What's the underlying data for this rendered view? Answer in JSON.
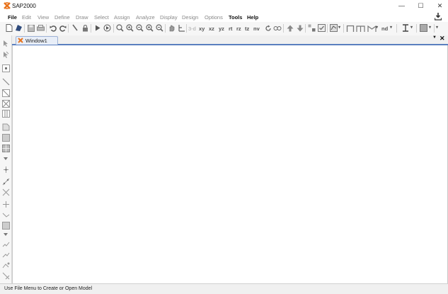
{
  "window": {
    "title": "SAP2000",
    "minimize_glyph": "—",
    "maximize_glyph": "☐",
    "close_glyph": "✕"
  },
  "menu": {
    "items": [
      "File",
      "Edit",
      "View",
      "Define",
      "Draw",
      "Select",
      "Assign",
      "Analyze",
      "Display",
      "Design",
      "Options",
      "Tools",
      "Help"
    ],
    "active": [
      "File",
      "Tools",
      "Help"
    ]
  },
  "toolbar": {
    "view_labels": [
      "3-d",
      "xy",
      "xz",
      "yz",
      "rt",
      "rz",
      "tz",
      "nv"
    ],
    "nd_label": "nd"
  },
  "tabs": {
    "window_label": "Window1",
    "dropdown_glyph": "▼",
    "close_glyph": "✕"
  },
  "status": {
    "text": "Use File Menu to Create or Open Model"
  },
  "colors": {
    "accent_tab_border": "#5a7fbf",
    "icon_orange": "#e8731c"
  }
}
